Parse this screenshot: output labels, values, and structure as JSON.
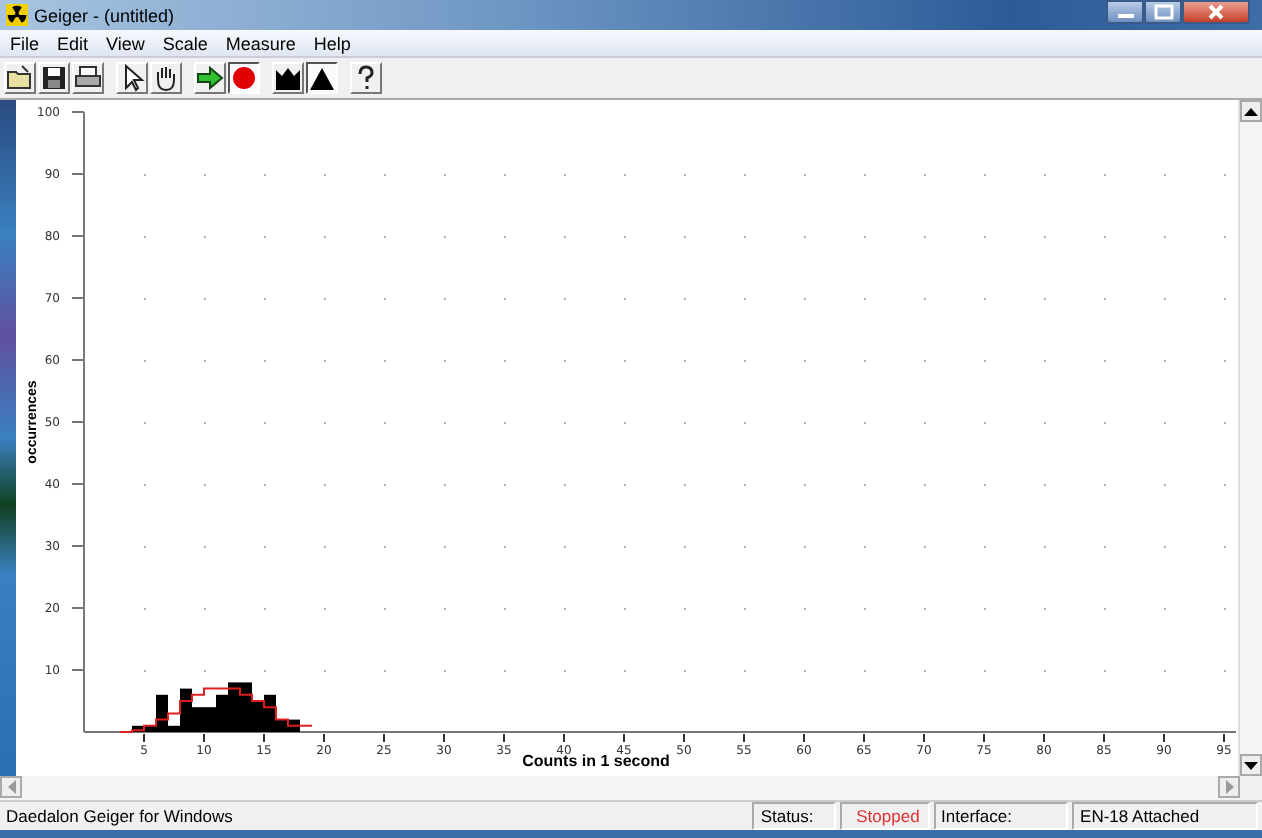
{
  "window": {
    "title": "Geiger - (untitled)"
  },
  "menu": [
    "File",
    "Edit",
    "View",
    "Scale",
    "Measure",
    "Help"
  ],
  "toolbar": [
    {
      "selected": false
    },
    {
      "selected": false
    },
    {
      "selected": false
    },
    {
      "selected": false
    },
    {
      "selected": false
    },
    {
      "selected": false
    },
    {
      "selected": true
    },
    {
      "selected": false
    },
    {
      "selected": true
    },
    {
      "selected": false
    }
  ],
  "chart": {
    "chart_data": {
      "type": "bar",
      "xlabel": "Counts in 1 second",
      "ylabel": "occurrences",
      "x": [
        4.5,
        5.5,
        6.5,
        7.5,
        8.5,
        9.5,
        10.5,
        11.5,
        12.5,
        13.5,
        14.5,
        15.5,
        16.5,
        17.5
      ],
      "values": [
        1,
        1,
        6,
        1,
        7,
        4,
        4,
        6,
        8,
        8,
        5,
        6,
        2,
        2
      ],
      "xlim": [
        0,
        96
      ],
      "ylim": [
        0,
        100
      ],
      "xticks": [
        5,
        10,
        15,
        20,
        25,
        30,
        35,
        40,
        45,
        50,
        55,
        60,
        65,
        70,
        75,
        80,
        85,
        90,
        95
      ],
      "yticks": [
        10,
        20,
        30,
        40,
        50,
        60,
        70,
        80,
        90,
        100
      ]
    }
  },
  "status_bar": {
    "app": "Daedalon Geiger for Windows",
    "status_label": "Status:",
    "status_value": "Stopped",
    "interface_label": "Interface:",
    "interface_value": "EN-18 Attached"
  }
}
